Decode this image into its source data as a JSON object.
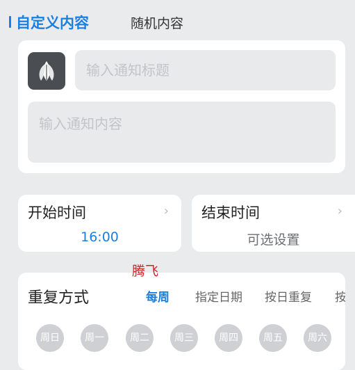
{
  "tabs": {
    "active": "自定义内容",
    "inactive": "随机内容"
  },
  "notification": {
    "title_placeholder": "输入通知标题",
    "content_placeholder": "输入通知内容"
  },
  "start_time": {
    "label": "开始时间",
    "value": "16:00"
  },
  "end_time": {
    "label": "结束时间",
    "value": "可选设置"
  },
  "chevron": "›",
  "watermark": "腾飞",
  "repeat": {
    "label": "重复方式",
    "modes": [
      "每周",
      "指定日期",
      "按日重复",
      "按"
    ],
    "active_mode": "每周",
    "days": [
      "周日",
      "周一",
      "周二",
      "周三",
      "周四",
      "周五",
      "周六"
    ]
  },
  "colors": {
    "accent": "#1a7fe0",
    "background": "#eaebed",
    "icon_bg": "#4a4d52",
    "day_off": "#cfd0d3"
  },
  "icons": {
    "app": "three-petal-leaf-icon"
  }
}
